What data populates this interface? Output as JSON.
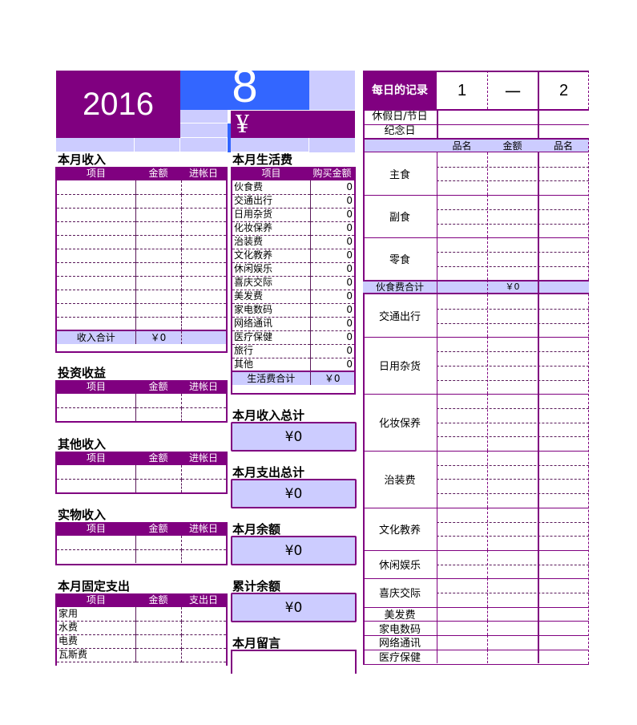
{
  "header": {
    "year": "2016",
    "month": "8",
    "currency_symbol": "¥"
  },
  "income": {
    "title": "本月收入",
    "columns": [
      "项目",
      "金额",
      "进帐日"
    ],
    "rows": [
      "",
      "",
      "",
      "",
      "",
      "",
      "",
      "",
      "",
      "",
      ""
    ],
    "total_label": "收入合计",
    "total_value": "￥0"
  },
  "investment": {
    "title": "投资收益",
    "columns": [
      "项目",
      "金额",
      "进帐日"
    ]
  },
  "other_income": {
    "title": "其他收入",
    "columns": [
      "项目",
      "金额",
      "进帐日"
    ]
  },
  "in_kind_income": {
    "title": "实物收入",
    "columns": [
      "项目",
      "金额",
      "进帐日"
    ]
  },
  "fixed_expense": {
    "title": "本月固定支出",
    "columns": [
      "项目",
      "金额",
      "支出日"
    ],
    "rows": [
      "家用",
      "水费",
      "电费",
      "瓦斯费"
    ]
  },
  "living_expense": {
    "title": "本月生活费",
    "columns": [
      "项目",
      "购买金额"
    ],
    "rows": [
      {
        "item": "伙食费",
        "amount": "0"
      },
      {
        "item": "交通出行",
        "amount": "0"
      },
      {
        "item": "日用杂货",
        "amount": "0"
      },
      {
        "item": "化妆保养",
        "amount": "0"
      },
      {
        "item": "治装费",
        "amount": "0"
      },
      {
        "item": "文化教养",
        "amount": "0"
      },
      {
        "item": "休闲娱乐",
        "amount": "0"
      },
      {
        "item": "喜庆交际",
        "amount": "0"
      },
      {
        "item": "美发费",
        "amount": "0"
      },
      {
        "item": "家电数码",
        "amount": "0"
      },
      {
        "item": "网络通讯",
        "amount": "0"
      },
      {
        "item": "医疗保健",
        "amount": "0"
      },
      {
        "item": "旅行",
        "amount": "0"
      },
      {
        "item": "其他",
        "amount": "0"
      }
    ],
    "total_label": "生活费合计",
    "total_value": "￥0"
  },
  "summary": {
    "income_total_title": "本月收入总计",
    "income_total_value": "¥0",
    "expense_total_title": "本月支出总计",
    "expense_total_value": "¥0",
    "balance_title": "本月余额",
    "balance_value": "¥0",
    "cumulative_title": "累计余额",
    "cumulative_value": "¥0",
    "memo_title": "本月留言",
    "memo_value": ""
  },
  "daily": {
    "title": "每日的记录",
    "day1": "1",
    "weekday1": "一",
    "day2": "2",
    "holiday_label": "休假日/节日",
    "anniversary_label": "纪念日",
    "col_name": "品名",
    "col_amount": "金额",
    "col_name2": "品名",
    "categories": [
      "主食",
      "副食",
      "零食",
      "交通出行",
      "日用杂货",
      "化妆保养",
      "治装费",
      "文化教养",
      "休闲娱乐",
      "喜庆交际",
      "美发费",
      "家电数码",
      "网络通讯",
      "医疗保健"
    ],
    "food_total_label": "伙食费合计",
    "food_total_value": "￥0"
  }
}
